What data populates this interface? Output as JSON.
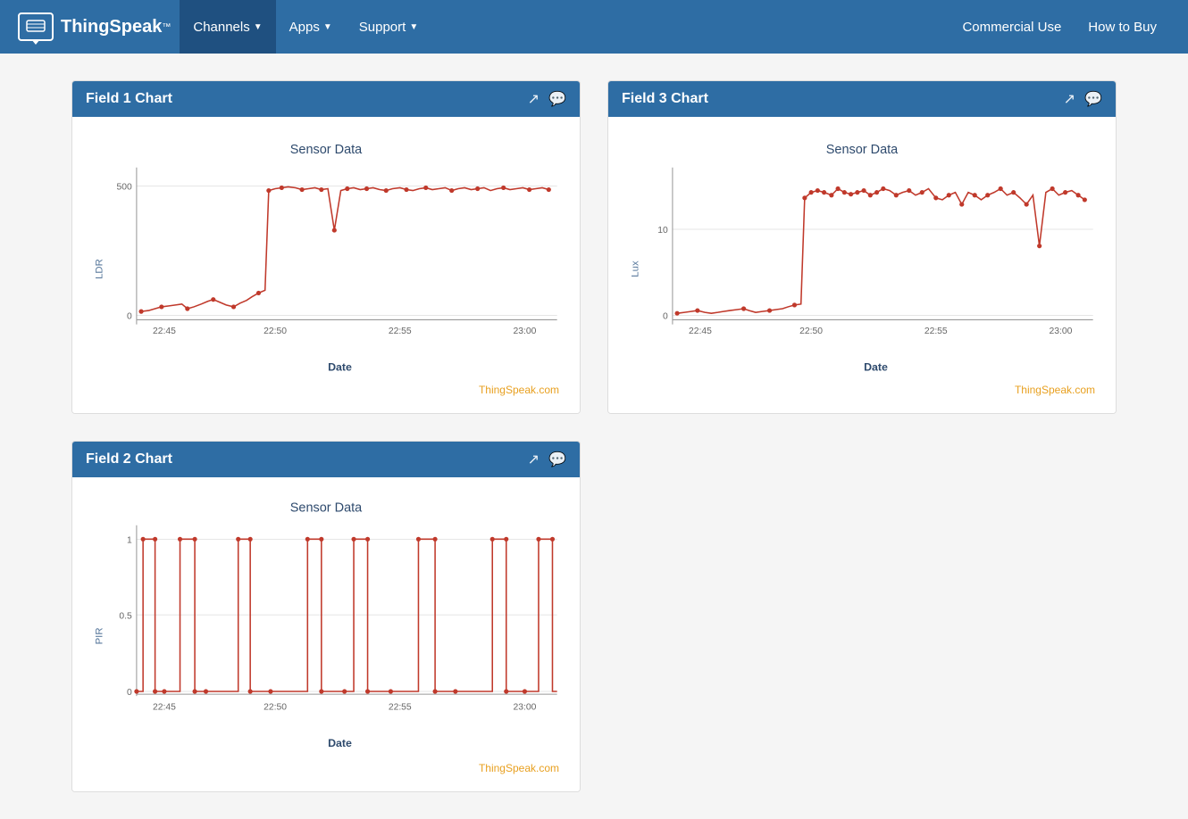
{
  "navbar": {
    "brand": "ThingSpeak",
    "brand_tm": "™",
    "channels_label": "Channels",
    "apps_label": "Apps",
    "support_label": "Support",
    "commercial_use_label": "Commercial Use",
    "how_to_buy_label": "How to Buy"
  },
  "charts": [
    {
      "id": "field1",
      "title": "Field 1 Chart",
      "chart_title": "Sensor Data",
      "y_label": "LDR",
      "x_label": "Date",
      "thingspeak": "ThingSpeak.com",
      "y_ticks": [
        "500",
        "0"
      ],
      "x_ticks": [
        "22:45",
        "22:50",
        "22:55",
        "23:00"
      ]
    },
    {
      "id": "field3",
      "title": "Field 3 Chart",
      "chart_title": "Sensor Data",
      "y_label": "Lux",
      "x_label": "Date",
      "thingspeak": "ThingSpeak.com",
      "y_ticks": [
        "10",
        "0"
      ],
      "x_ticks": [
        "22:45",
        "22:50",
        "22:55",
        "23:00"
      ]
    },
    {
      "id": "field2",
      "title": "Field 2 Chart",
      "chart_title": "Sensor Data",
      "y_label": "PIR",
      "x_label": "Date",
      "thingspeak": "ThingSpeak.com",
      "y_ticks": [
        "1",
        "0.5",
        "0"
      ],
      "x_ticks": [
        "22:45",
        "22:50",
        "22:55",
        "23:00"
      ]
    }
  ]
}
